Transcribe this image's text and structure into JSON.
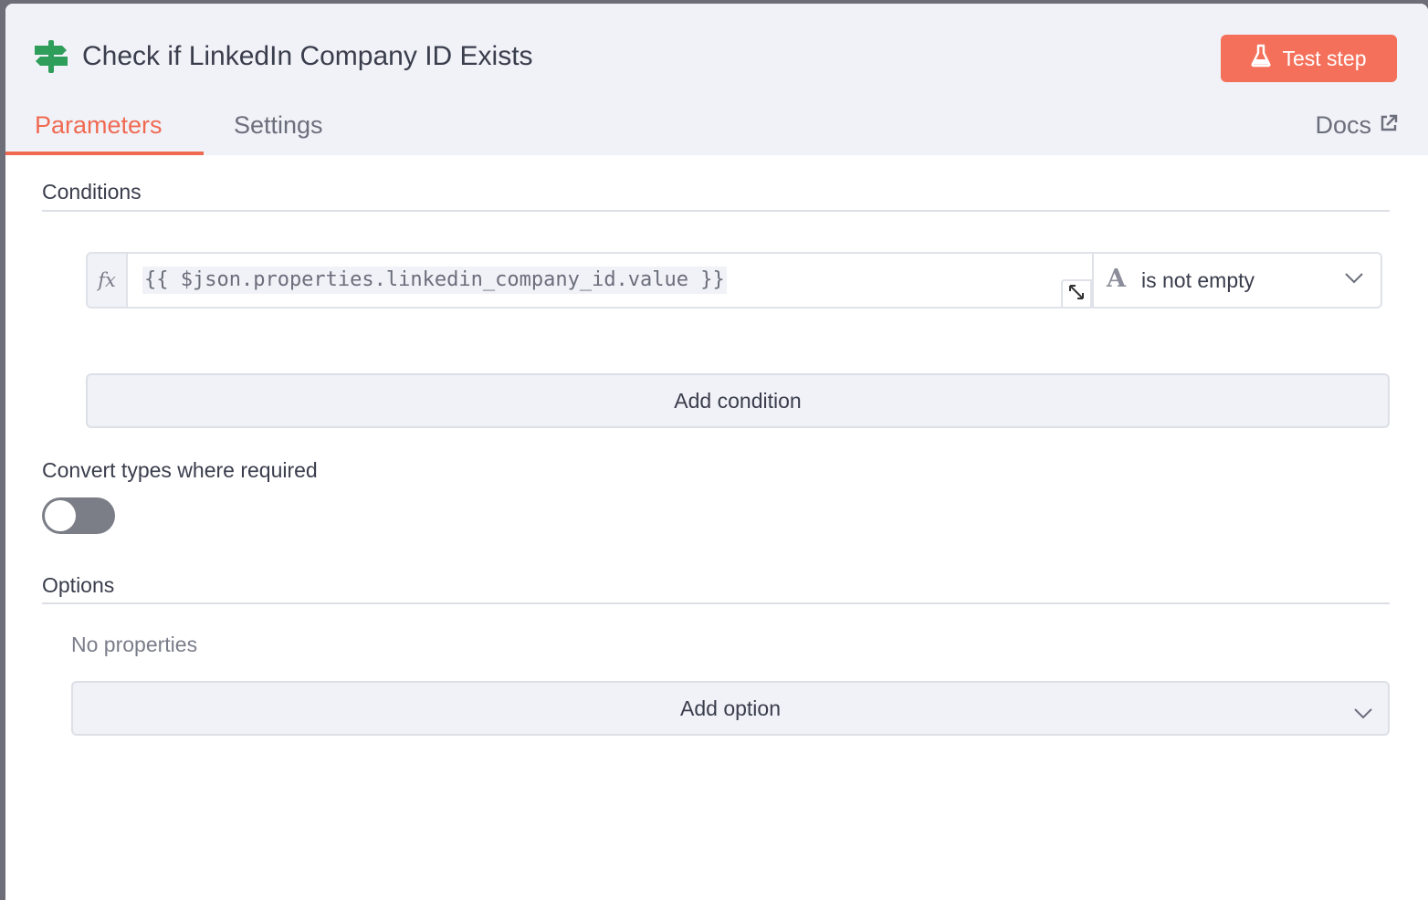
{
  "header": {
    "title": "Check if LinkedIn Company ID Exists",
    "node_icon": "signpost-icon",
    "test_button_label": "Test step",
    "test_button_icon": "flask-icon",
    "accent_color": "#f4705a"
  },
  "tabs": [
    {
      "label": "Parameters",
      "active": true
    },
    {
      "label": "Settings",
      "active": false
    }
  ],
  "docs": {
    "label": "Docs",
    "icon": "external-link-icon"
  },
  "conditions": {
    "section_label": "Conditions",
    "rows": [
      {
        "expression_prefix": "fx",
        "expression": "{{ $json.properties.linkedin_company_id.value }}",
        "operator_type_glyph": "A",
        "operator": "is not empty"
      }
    ],
    "add_button_label": "Add condition"
  },
  "convert_types": {
    "label": "Convert types where required",
    "enabled": false
  },
  "options": {
    "section_label": "Options",
    "empty_text": "No properties",
    "add_button_label": "Add option"
  }
}
